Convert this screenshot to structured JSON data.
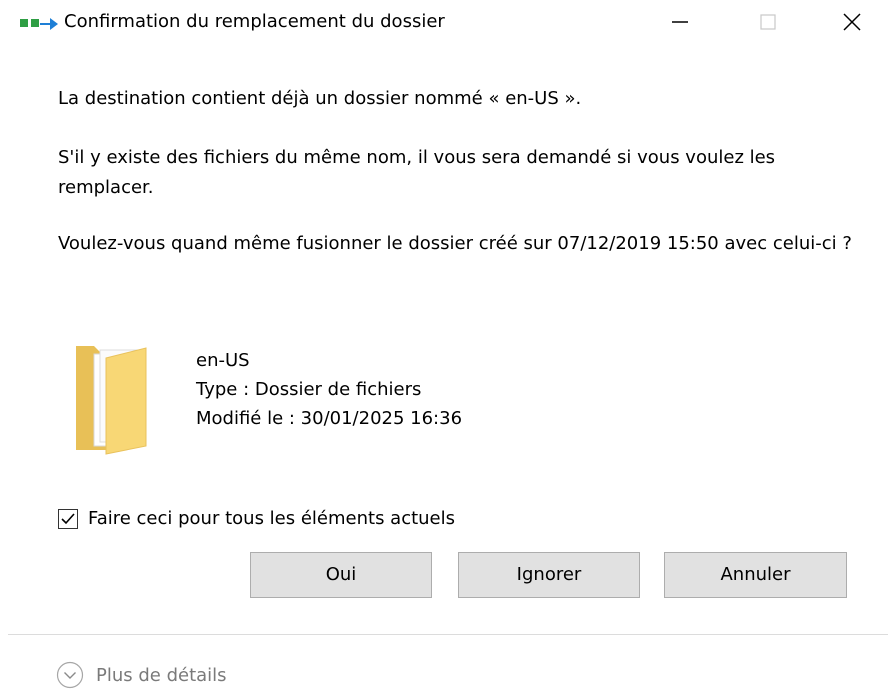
{
  "window": {
    "title": "Confirmation du remplacement du dossier",
    "controls": {
      "minimize": "minimize-icon",
      "maximize": "maximize-icon",
      "close": "close-icon"
    }
  },
  "message": {
    "line1": "La destination contient déjà un dossier nommé « en-US ».",
    "line2": "S'il y existe des fichiers du même nom, il vous sera demandé si vous voulez les remplacer.",
    "line3": "Voulez-vous quand même fusionner le dossier créé sur 07/12/2019 15:50 avec celui-ci ?"
  },
  "item": {
    "icon": "folder-icon",
    "name": "en-US",
    "type": "Type : Dossier de fichiers",
    "modified": "Modifié le : 30/01/2025 16:36"
  },
  "apply_all": {
    "label": "Faire ceci pour tous les éléments actuels",
    "checked": true
  },
  "buttons": {
    "yes": "Oui",
    "skip": "Ignorer",
    "cancel": "Annuler"
  },
  "details": {
    "label": "Plus de détails",
    "icon": "chevron-down-circle-icon"
  },
  "colors": {
    "button_bg": "#e1e1e1",
    "button_border": "#adadad",
    "details_text": "#7a7a7a",
    "folder": "#f8d775"
  }
}
